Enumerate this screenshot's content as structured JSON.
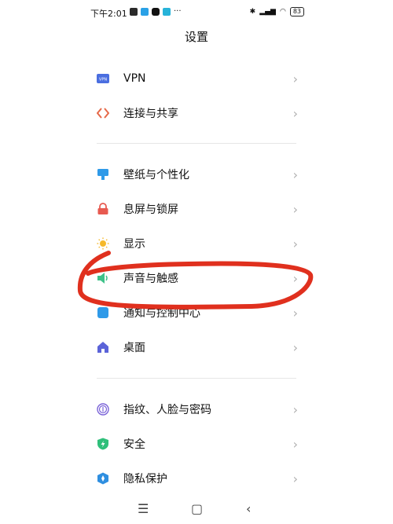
{
  "status": {
    "time": "下午2:01",
    "more": "···",
    "battery": "83"
  },
  "header": {
    "title": "设置"
  },
  "items": [
    {
      "id": "vpn",
      "label": "VPN",
      "icon": "vpn-icon"
    },
    {
      "id": "connect",
      "label": "连接与共享",
      "icon": "share-icon"
    },
    {
      "id": "wallpaper",
      "label": "壁纸与个性化",
      "icon": "wallpaper-icon"
    },
    {
      "id": "lockscreen",
      "label": "息屏与锁屏",
      "icon": "lock-icon"
    },
    {
      "id": "display",
      "label": "显示",
      "icon": "sun-icon"
    },
    {
      "id": "sound",
      "label": "声音与触感",
      "icon": "speaker-icon"
    },
    {
      "id": "notify",
      "label": "通知与控制中心",
      "icon": "notification-icon"
    },
    {
      "id": "desktop",
      "label": "桌面",
      "icon": "home-icon"
    },
    {
      "id": "biometric",
      "label": "指纹、人脸与密码",
      "icon": "fingerprint-icon"
    },
    {
      "id": "security",
      "label": "安全",
      "icon": "shield-icon"
    },
    {
      "id": "privacy",
      "label": "隐私保护",
      "icon": "privacy-icon"
    }
  ],
  "navbar": {
    "menu": "☰",
    "home": "▢",
    "back": "‹"
  },
  "colors": {
    "accent_red": "#e0301e",
    "chevron": "#b0b0b0"
  }
}
